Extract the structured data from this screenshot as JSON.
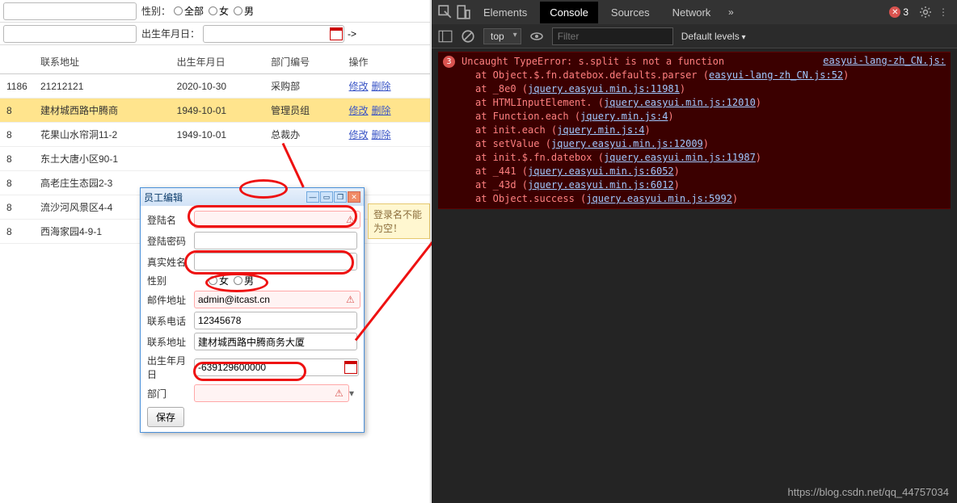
{
  "filters": {
    "sex_label": "性别：",
    "sex_all": "全部",
    "sex_female": "女",
    "sex_male": "男",
    "dob_label": "出生年月日：",
    "arrow": "->"
  },
  "table": {
    "headers": {
      "addr": "联系地址",
      "dob": "出生年月日",
      "dept": "部门编号",
      "ops": "操作"
    },
    "rows": [
      {
        "c0": "1186",
        "addr": "21212121",
        "dob": "2020-10-30",
        "dept": "采购部",
        "edit": "修改",
        "del": "删除"
      },
      {
        "c0": "8",
        "addr": "建材城西路中腾商",
        "dob": "1949-10-01",
        "dept": "管理员组",
        "edit": "修改",
        "del": "删除"
      },
      {
        "c0": "8",
        "addr": "花果山水帘洞11-2",
        "dob": "1949-10-01",
        "dept": "总裁办",
        "edit": "修改",
        "del": "删除"
      },
      {
        "c0": "8",
        "addr": "东土大唐小区90-1",
        "dob": "",
        "dept": "",
        "edit": "",
        "del": ""
      },
      {
        "c0": "8",
        "addr": "高老庄生态园2-3",
        "dob": "",
        "dept": "",
        "edit": "",
        "del": ""
      },
      {
        "c0": "8",
        "addr": "流沙河风景区4-4",
        "dob": "",
        "dept": "",
        "edit": "",
        "del": ""
      },
      {
        "c0": "8",
        "addr": "西海家园4-9-1",
        "dob": "",
        "dept": "",
        "edit": "",
        "del": ""
      }
    ]
  },
  "dialog": {
    "title": "员工编辑",
    "fields": {
      "login": {
        "label": "登陆名",
        "value": ""
      },
      "pwd": {
        "label": "登陆密码",
        "value": ""
      },
      "real": {
        "label": "真实姓名",
        "value": ""
      },
      "sex": {
        "label": "性别",
        "female": "女",
        "male": "男"
      },
      "mail": {
        "label": "邮件地址",
        "value": "admin@itcast.cn"
      },
      "tel": {
        "label": "联系电话",
        "value": "12345678"
      },
      "addr": {
        "label": "联系地址",
        "value": "建材城西路中腾商务大厦"
      },
      "dob": {
        "label": "出生年月日",
        "value": "-639129600000"
      },
      "dept": {
        "label": "部门",
        "value": ""
      }
    },
    "save": "保存",
    "tooltip": "登录名不能为空！"
  },
  "devtools": {
    "tabs": {
      "elements": "Elements",
      "console": "Console",
      "sources": "Sources",
      "network": "Network"
    },
    "err_count": "3",
    "context": "top",
    "filter_ph": "Filter",
    "levels": "Default levels",
    "error": {
      "msg": "Uncaught TypeError: s.split is not a function",
      "src": "easyui-lang-zh_CN.js:",
      "stack": [
        {
          "t": "at Object.$.fn.datebox.defaults.parser (",
          "s": "easyui-lang-zh_CN.js:52"
        },
        {
          "t": "at _8e0 (",
          "s": "jquery.easyui.min.js:11981"
        },
        {
          "t": "at HTMLInputElement.<anonymous> (",
          "s": "jquery.easyui.min.js:12010"
        },
        {
          "t": "at Function.each (",
          "s": "jquery.min.js:4"
        },
        {
          "t": "at init.each (",
          "s": "jquery.min.js:4"
        },
        {
          "t": "at setValue (",
          "s": "jquery.easyui.min.js:12009"
        },
        {
          "t": "at init.$.fn.datebox (",
          "s": "jquery.easyui.min.js:11987"
        },
        {
          "t": "at _441 (",
          "s": "jquery.easyui.min.js:6052"
        },
        {
          "t": "at _43d (",
          "s": "jquery.easyui.min.js:6012"
        },
        {
          "t": "at Object.success (",
          "s": "jquery.easyui.min.js:5992"
        }
      ]
    }
  },
  "watermark": "https://blog.csdn.net/qq_44757034"
}
